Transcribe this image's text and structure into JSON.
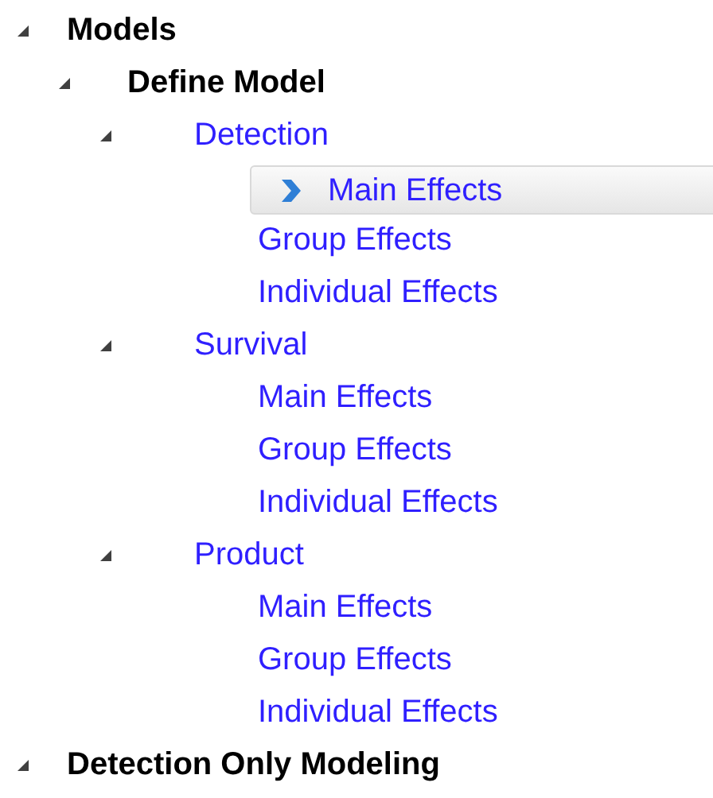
{
  "tree": [
    {
      "label": "Models",
      "kind": "section",
      "expanded": true,
      "selected": false,
      "children": [
        {
          "label": "Define Model",
          "kind": "section",
          "expanded": true,
          "selected": false,
          "children": [
            {
              "label": "Detection",
              "kind": "link",
              "expanded": true,
              "selected": false,
              "children": [
                {
                  "label": "Main Effects",
                  "kind": "link",
                  "selected": true
                },
                {
                  "label": "Group Effects",
                  "kind": "link",
                  "selected": false
                },
                {
                  "label": "Individual Effects",
                  "kind": "link",
                  "selected": false
                }
              ]
            },
            {
              "label": "Survival",
              "kind": "link",
              "expanded": true,
              "selected": false,
              "children": [
                {
                  "label": "Main Effects",
                  "kind": "link",
                  "selected": false
                },
                {
                  "label": "Group Effects",
                  "kind": "link",
                  "selected": false
                },
                {
                  "label": "Individual Effects",
                  "kind": "link",
                  "selected": false
                }
              ]
            },
            {
              "label": "Product",
              "kind": "link",
              "expanded": true,
              "selected": false,
              "children": [
                {
                  "label": "Main Effects",
                  "kind": "link",
                  "selected": false
                },
                {
                  "label": "Group Effects",
                  "kind": "link",
                  "selected": false
                },
                {
                  "label": "Individual Effects",
                  "kind": "link",
                  "selected": false
                }
              ]
            }
          ]
        }
      ]
    },
    {
      "label": "Detection Only Modeling",
      "kind": "section",
      "expanded": true,
      "selected": false
    }
  ]
}
